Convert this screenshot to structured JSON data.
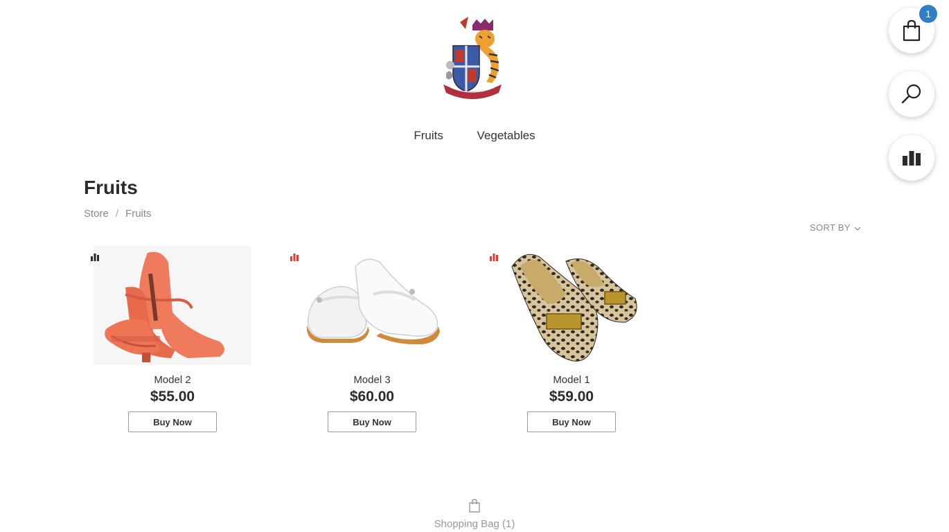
{
  "nav": {
    "items": [
      {
        "label": "Fruits"
      },
      {
        "label": "Vegetables"
      }
    ]
  },
  "page": {
    "title": "Fruits"
  },
  "breadcrumb": {
    "items": [
      {
        "label": "Store"
      },
      {
        "label": "Fruits"
      }
    ],
    "separator": "/"
  },
  "sort": {
    "label": "SORT BY"
  },
  "products": [
    {
      "name": "Model 2",
      "price": "$55.00",
      "button": "Buy Now",
      "compare_icon_color": "#2b2b2b",
      "image": "coral-heel-shoe-image"
    },
    {
      "name": "Model 3",
      "price": "$60.00",
      "button": "Buy Now",
      "compare_icon_color": "#e53935",
      "image": "white-flat-shoe-image"
    },
    {
      "name": "Model 1",
      "price": "$59.00",
      "button": "Buy Now",
      "compare_icon_color": "#e53935",
      "image": "leopard-flat-shoe-image"
    }
  ],
  "floating": {
    "cart_count": "1",
    "cart_icon": "shopping-bag-icon",
    "search_icon": "search-icon",
    "compare_icon": "bar-chart-icon"
  },
  "footer": {
    "bag_label": "Shopping Bag (1)"
  },
  "colors": {
    "badge": "#2f7fc6",
    "accent_red": "#e53935"
  }
}
